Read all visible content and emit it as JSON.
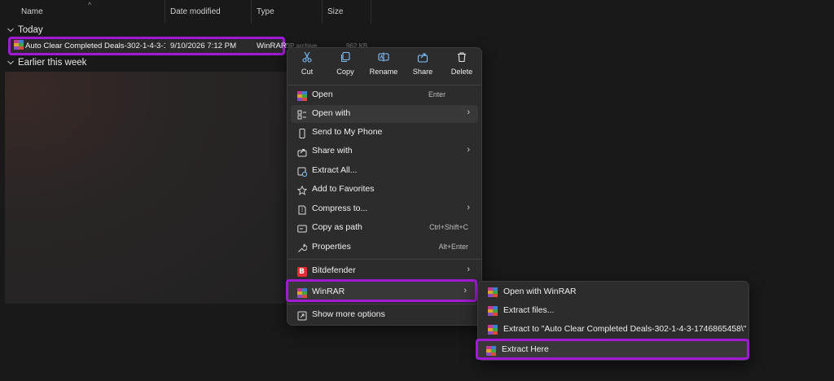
{
  "columns": {
    "name": "Name",
    "date_modified": "Date modified",
    "type": "Type",
    "size": "Size"
  },
  "groups": {
    "today": "Today",
    "earlier": "Earlier this week"
  },
  "file": {
    "name": "Auto Clear Completed Deals-302-1-4-3-1...",
    "date": "9/10/2026 7:12 PM",
    "type": "WinRAR",
    "type_partial_hidden": "ZIP archive",
    "size_partial_hidden": "962 KB"
  },
  "context_menu": {
    "toolbar": [
      {
        "label": "Cut",
        "icon": "scissors-icon"
      },
      {
        "label": "Copy",
        "icon": "copy-icon"
      },
      {
        "label": "Rename",
        "icon": "rename-icon"
      },
      {
        "label": "Share",
        "icon": "share-icon"
      },
      {
        "label": "Delete",
        "icon": "trash-icon"
      }
    ],
    "items": [
      {
        "label": "Open",
        "shortcut": "Enter",
        "icon": "winrar-icon"
      },
      {
        "label": "Open with",
        "icon": "open-with-icon",
        "submenu": true
      },
      {
        "label": "Send to My Phone",
        "icon": "phone-icon"
      },
      {
        "label": "Share with",
        "icon": "share-with-icon",
        "submenu": true
      },
      {
        "label": "Extract All...",
        "icon": "extract-all-icon"
      },
      {
        "label": "Add to Favorites",
        "icon": "star-icon"
      },
      {
        "label": "Compress to...",
        "icon": "compress-icon",
        "submenu": true
      },
      {
        "label": "Copy as path",
        "shortcut": "Ctrl+Shift+C",
        "icon": "copy-path-icon"
      },
      {
        "label": "Properties",
        "shortcut": "Alt+Enter",
        "icon": "wrench-icon"
      },
      {
        "label": "Bitdefender",
        "icon": "bitdefender-icon",
        "submenu": true
      },
      {
        "label": "WinRAR",
        "icon": "winrar-icon",
        "submenu": true
      },
      {
        "label": "Show more options",
        "icon": "more-options-icon"
      }
    ]
  },
  "winrar_submenu": {
    "items": [
      {
        "label": "Open with WinRAR"
      },
      {
        "label": "Extract files..."
      },
      {
        "label": "Extract to \"Auto Clear Completed Deals-302-1-4-3-1746865458\\\""
      },
      {
        "label": "Extract Here"
      }
    ]
  },
  "colors": {
    "highlight": "#a21ad8",
    "background": "#191919",
    "menu_bg": "#2c2c2c",
    "accent_icon": "#7fbfff"
  }
}
